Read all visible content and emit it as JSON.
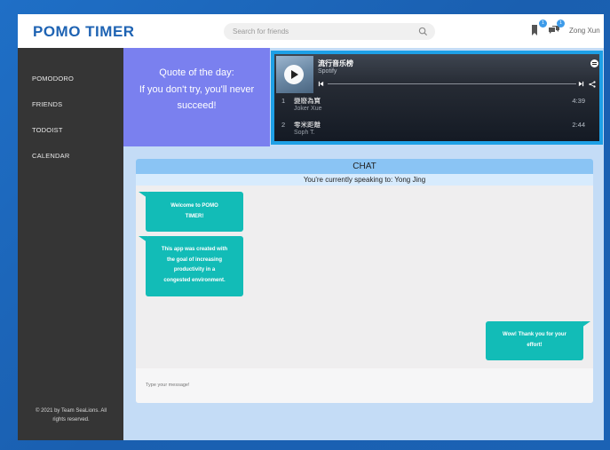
{
  "header": {
    "brand": "POMO TIMER",
    "search_placeholder": "Search for friends",
    "notifications_badge": "1",
    "messages_badge": "1",
    "user_name": "Zong Xun"
  },
  "sidebar": {
    "items": [
      {
        "label": "POMODORO"
      },
      {
        "label": "FRIENDS"
      },
      {
        "label": "TODOIST"
      },
      {
        "label": "CALENDAR"
      }
    ],
    "footer_line1": "© 2021 by Team SeaLions. All",
    "footer_line2": "rights reserved."
  },
  "quote": {
    "title": "Quote of the day:",
    "line1": "If you don't try, you'll never",
    "line2": "succeed!"
  },
  "spotify": {
    "playlist_title": "流行音乐榜",
    "source": "Spotify",
    "tracks": [
      {
        "number": "1",
        "name": "變廢為寶",
        "artist": "Joker Xue",
        "duration": "4:39"
      },
      {
        "number": "2",
        "name": "零米距離",
        "artist": "Soph T.",
        "duration": "2:44"
      }
    ]
  },
  "chat": {
    "title": "CHAT",
    "speaking_to": "You're currently speaking to: Yong Jing",
    "messages": [
      {
        "side": "received",
        "lines": [
          "Welcome to POMO",
          "TIMER!"
        ]
      },
      {
        "side": "received",
        "lines": [
          "This app was created with",
          "the goal of increasing",
          "productivity in a",
          "congested environment."
        ]
      },
      {
        "side": "sent",
        "lines": [
          "Wow! Thank you for your",
          "effort!"
        ]
      }
    ],
    "input_placeholder": "Type your message!"
  },
  "colors": {
    "brand": "#1e63b3",
    "sidebar": "#353535",
    "quote_bg": "#7a80ef",
    "chat_bubble": "#12bcb7",
    "chat_header": "#8ac4f4",
    "content_bg": "#c4dcf6"
  }
}
